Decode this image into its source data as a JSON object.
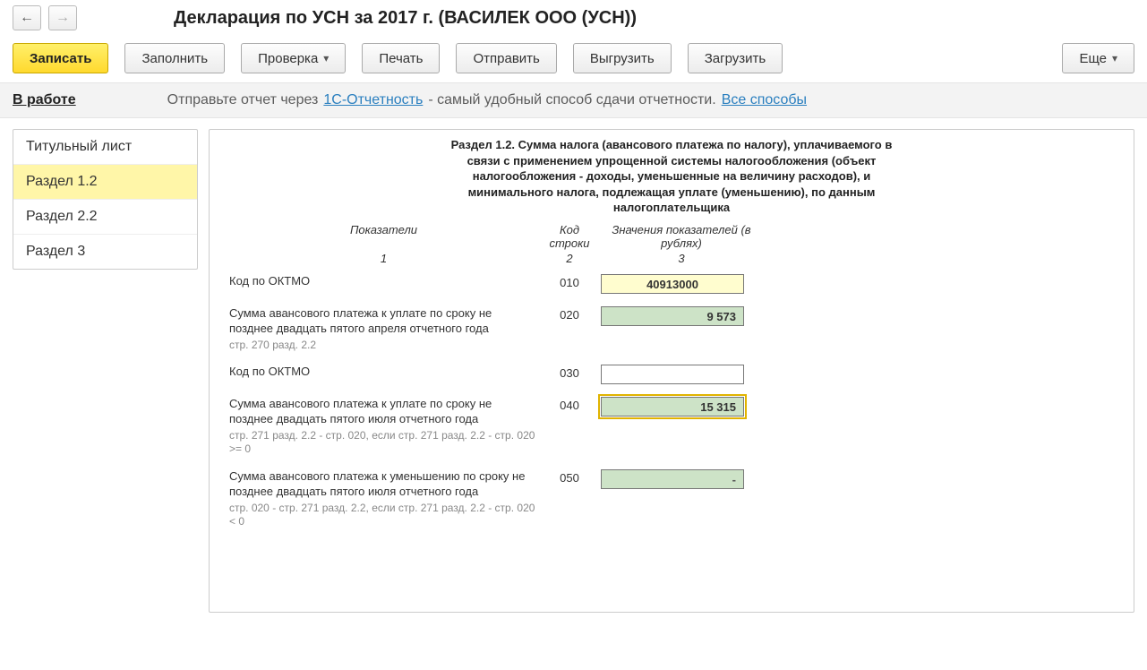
{
  "header": {
    "title": "Декларация по УСН за 2017 г. (ВАСИЛЕК ООО (УСН))"
  },
  "toolbar": {
    "save": "Записать",
    "fill": "Заполнить",
    "check": "Проверка",
    "print": "Печать",
    "send": "Отправить",
    "export": "Выгрузить",
    "import": "Загрузить",
    "more": "Еще"
  },
  "status_bar": {
    "status": "В работе",
    "msg_prefix": "Отправьте отчет через ",
    "link1": "1С-Отчетность",
    "msg_middle": " - самый удобный способ сдачи отчетности. ",
    "link2": "Все способы"
  },
  "tabs": [
    {
      "label": "Титульный лист"
    },
    {
      "label": "Раздел 1.2"
    },
    {
      "label": "Раздел 2.2"
    },
    {
      "label": "Раздел 3"
    }
  ],
  "section": {
    "title": "Раздел 1.2. Сумма налога (авансового платежа по налогу), уплачиваемого в связи с применением упрощенной системы налогообложения (объект налогообложения - доходы, уменьшенные на величину расходов), и минимального налога, подлежащая уплате (уменьшению), по данным налогоплательщика",
    "cols": {
      "c1": "Показатели",
      "c2": "Код строки",
      "c3": "Значения показателей (в рублях)"
    },
    "colnums": {
      "c1": "1",
      "c2": "2",
      "c3": "3"
    },
    "rows": [
      {
        "label": "Код по ОКТМО",
        "sub": "",
        "code": "010",
        "value": "40913000",
        "style": "yellow"
      },
      {
        "label": "Сумма авансового платежа к уплате по сроку не позднее двадцать пятого апреля отчетного года",
        "sub": "стр. 270 разд. 2.2",
        "code": "020",
        "value": "9 573",
        "style": "green"
      },
      {
        "label": "Код по ОКТМО",
        "sub": "",
        "code": "030",
        "value": "",
        "style": "white"
      },
      {
        "label": "Сумма  авансового платежа к уплате по сроку не позднее двадцать пятого июля отчетного года",
        "sub": "стр. 271 разд. 2.2 - стр. 020,\nесли стр. 271 разд. 2.2 - стр. 020 >= 0",
        "code": "040",
        "value": "15 315",
        "style": "green highlight"
      },
      {
        "label": "Сумма авансового платежа к уменьшению по сроку не позднее двадцать пятого июля отчетного года",
        "sub": "стр. 020 - стр. 271 разд. 2.2,\nесли стр. 271 разд. 2.2 - стр. 020 < 0",
        "code": "050",
        "value": "-",
        "style": "green dash"
      }
    ]
  }
}
